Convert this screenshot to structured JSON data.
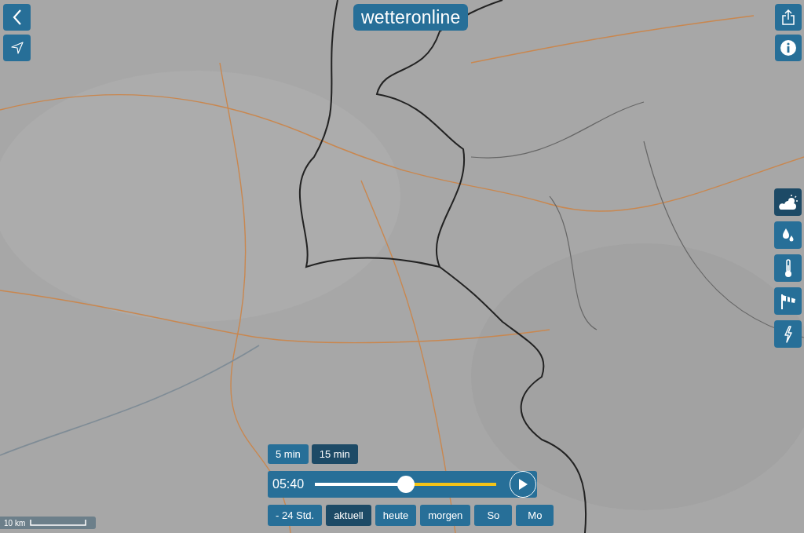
{
  "logo": "wetteronline",
  "layers": [
    {
      "kind": "weather",
      "selected": true
    },
    {
      "kind": "rain",
      "selected": false
    },
    {
      "kind": "temperature",
      "selected": false
    },
    {
      "kind": "wind",
      "selected": false
    },
    {
      "kind": "lightning",
      "selected": false
    }
  ],
  "intervals": [
    {
      "label": "5 min",
      "selected": false
    },
    {
      "label": "15 min",
      "selected": true
    }
  ],
  "player": {
    "time": "05:40",
    "level": 0.5
  },
  "days": [
    {
      "label": "- 24 Std.",
      "selected": false
    },
    {
      "label": "aktuell",
      "selected": true
    },
    {
      "label": "heute",
      "selected": false
    },
    {
      "label": "morgen",
      "selected": false
    },
    {
      "label": "So",
      "selected": false
    },
    {
      "label": "Mo",
      "selected": false
    }
  ],
  "scale": {
    "label": "10 km"
  }
}
